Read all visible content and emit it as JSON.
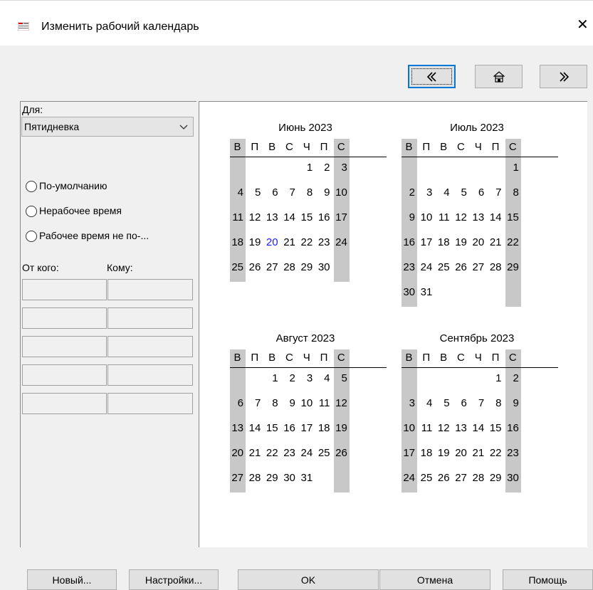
{
  "window": {
    "title": "Изменить рабочий календарь",
    "close_glyph": "✕"
  },
  "nav": {
    "prev_icon": "double-chevron-left-icon",
    "home_icon": "home-icon",
    "next_icon": "double-chevron-right-icon"
  },
  "left": {
    "for_label": "Для:",
    "calendar_select": "Пятидневка",
    "radios": [
      "По-умолчанию",
      "Нерабочее время",
      "Рабочее время не по-..."
    ],
    "from_label": "От кого:",
    "to_label": "Кому:"
  },
  "calendar": {
    "weekdays": [
      "В",
      "П",
      "В",
      "С",
      "Ч",
      "П",
      "С"
    ],
    "highlight_color": "#1a1aff",
    "weekend_color": "#c8c8c8",
    "months": [
      {
        "title": "Июнь 2023",
        "start": 4,
        "days": 30,
        "highlight": 20
      },
      {
        "title": "Июль 2023",
        "start": 6,
        "days": 31,
        "highlight": null
      },
      {
        "title": "Август 2023",
        "start": 2,
        "days": 31,
        "highlight": null
      },
      {
        "title": "Сентябрь 2023",
        "start": 5,
        "days": 30,
        "highlight": null
      }
    ]
  },
  "buttons": {
    "new": "Новый...",
    "settings": "Настройки...",
    "ok": "OK",
    "cancel": "Отмена",
    "help": "Помощь"
  }
}
